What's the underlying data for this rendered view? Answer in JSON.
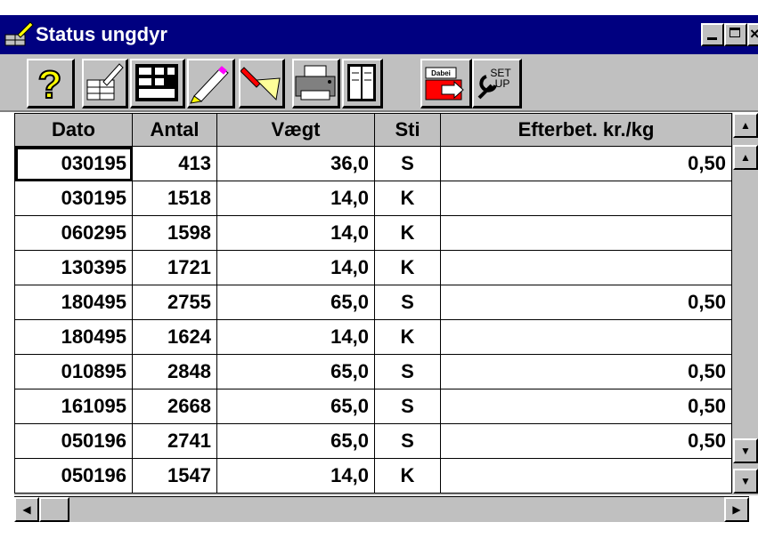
{
  "window": {
    "title": "Status  ungdyr",
    "controls": [
      "minimize-icon",
      "maximize-icon",
      "close-icon"
    ]
  },
  "toolbar": {
    "buttons": [
      {
        "icon": "help-icon"
      },
      {
        "icon": "edit-record-icon"
      },
      {
        "icon": "calculator-icon"
      },
      {
        "icon": "pencil-icon"
      },
      {
        "icon": "flashlight-icon"
      },
      {
        "icon": "printer-icon"
      },
      {
        "icon": "columns-icon"
      },
      {
        "icon": "exit-icon",
        "label": "Dabei"
      },
      {
        "icon": "setup-icon",
        "label": "SET UP"
      }
    ]
  },
  "grid": {
    "columns": [
      "Dato",
      "Antal",
      "Vægt",
      "Sti",
      "Efterbet. kr./kg"
    ],
    "rows": [
      {
        "dato": "030195",
        "antal": "413",
        "vaegt": "36,0",
        "sti": "S",
        "efterbet": "0,50"
      },
      {
        "dato": "030195",
        "antal": "1518",
        "vaegt": "14,0",
        "sti": "K",
        "efterbet": ""
      },
      {
        "dato": "060295",
        "antal": "1598",
        "vaegt": "14,0",
        "sti": "K",
        "efterbet": ""
      },
      {
        "dato": "130395",
        "antal": "1721",
        "vaegt": "14,0",
        "sti": "K",
        "efterbet": ""
      },
      {
        "dato": "180495",
        "antal": "2755",
        "vaegt": "65,0",
        "sti": "S",
        "efterbet": "0,50"
      },
      {
        "dato": "180495",
        "antal": "1624",
        "vaegt": "14,0",
        "sti": "K",
        "efterbet": ""
      },
      {
        "dato": "010895",
        "antal": "2848",
        "vaegt": "65,0",
        "sti": "S",
        "efterbet": "0,50"
      },
      {
        "dato": "161095",
        "antal": "2668",
        "vaegt": "65,0",
        "sti": "S",
        "efterbet": "0,50"
      },
      {
        "dato": "050196",
        "antal": "2741",
        "vaegt": "65,0",
        "sti": "S",
        "efterbet": "0,50"
      },
      {
        "dato": "050196",
        "antal": "1547",
        "vaegt": "14,0",
        "sti": "K",
        "efterbet": ""
      }
    ]
  },
  "colors": {
    "titlebar": "#000080",
    "face": "#c0c0c0"
  }
}
